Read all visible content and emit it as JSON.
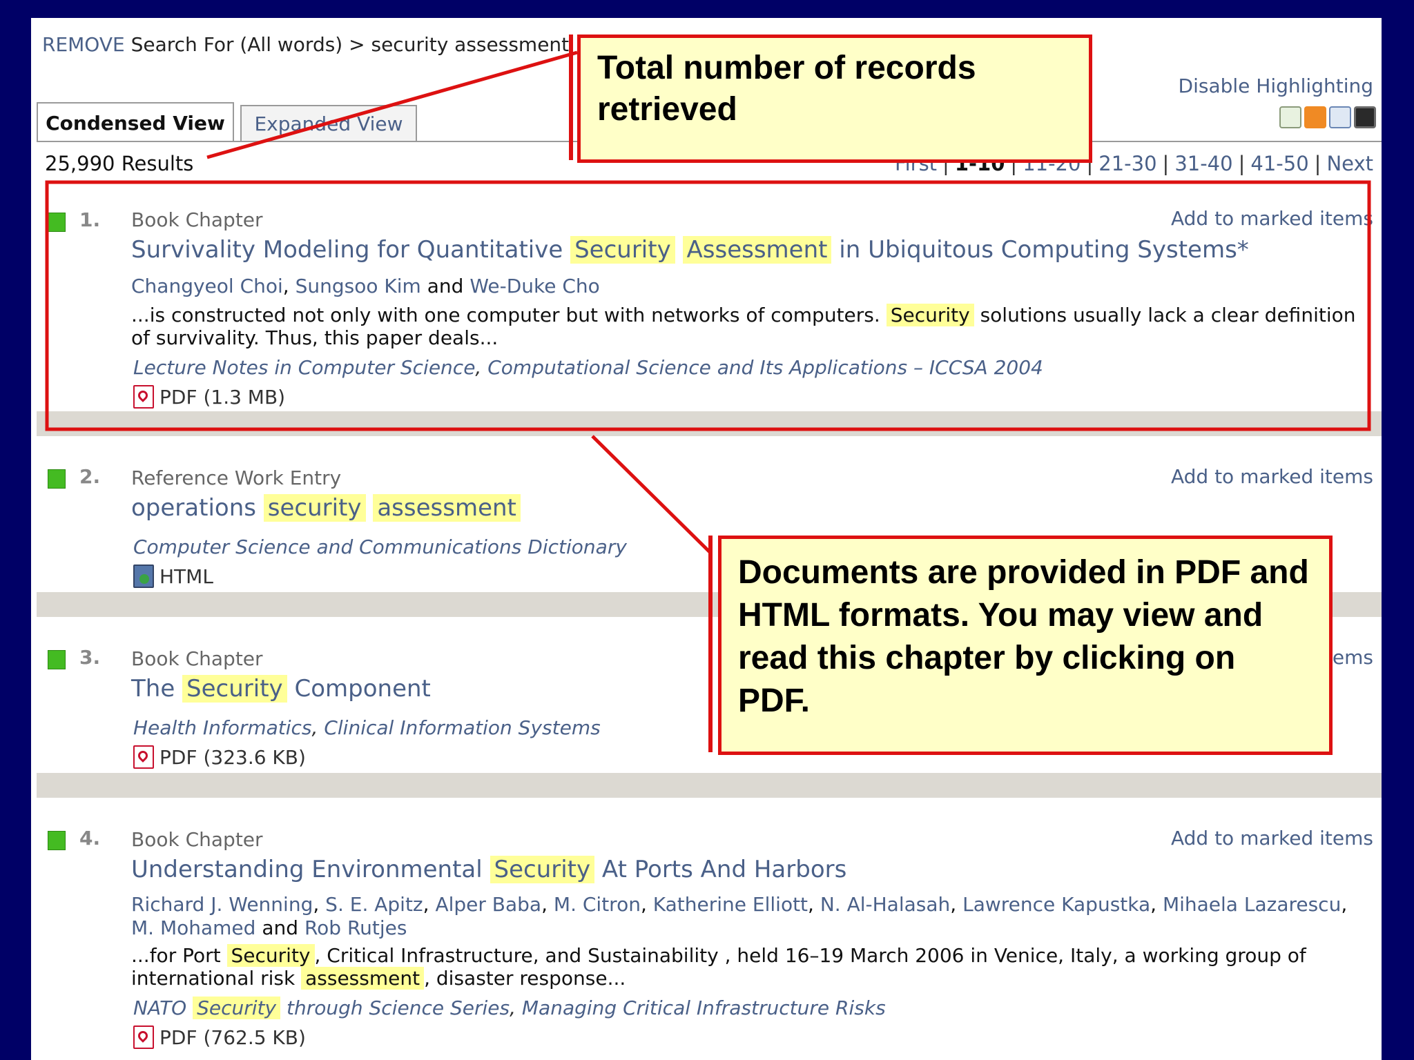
{
  "breadcrumb": {
    "remove": "REMOVE",
    "text": "Search For (All words) > security assessment"
  },
  "disable_highlighting": "Disable Highlighting",
  "tabs": [
    {
      "label": "Condensed View",
      "active": true
    },
    {
      "label": "Expanded View",
      "active": false
    }
  ],
  "results_count": "25,990 Results",
  "pager": {
    "first": "First",
    "pages": [
      "1-10",
      "11-20",
      "21-30",
      "31-40",
      "41-50"
    ],
    "next": "Next"
  },
  "add_to_marked": "Add to marked items",
  "results": [
    {
      "num": "1.",
      "type": "Book Chapter",
      "title_parts": [
        "Survivality Modeling for Quantitative ",
        "Security",
        " ",
        "Assessment",
        " in Ubiquitous Computing Systems*"
      ],
      "authors": [
        "Changyeol Choi",
        "Sungsoo Kim",
        "We-Duke Cho"
      ],
      "snippet_parts": [
        "...is constructed not only with one computer but with networks of computers. ",
        "Security",
        " solutions usually lack a clear definition of survivality. Thus, this paper deals..."
      ],
      "source": [
        "Lecture Notes in Computer Science",
        "Computational Science and Its Applications – ICCSA 2004"
      ],
      "format": "PDF (1.3 MB)"
    },
    {
      "num": "2.",
      "type": "Reference Work Entry",
      "title_parts": [
        "operations ",
        "security",
        " ",
        "assessment"
      ],
      "source": [
        "Computer Science and Communications Dictionary"
      ],
      "format": "HTML"
    },
    {
      "num": "3.",
      "type": "Book Chapter",
      "title_parts": [
        "The ",
        "Security",
        " Component"
      ],
      "source": [
        "Health Informatics",
        "Clinical Information Systems"
      ],
      "format": "PDF (323.6 KB)",
      "add_partial": "ems"
    },
    {
      "num": "4.",
      "type": "Book Chapter",
      "title_parts": [
        "Understanding Environmental ",
        "Security",
        " At Ports And Harbors"
      ],
      "authors": [
        "Richard J. Wenning",
        "S. E. Apitz",
        "Alper Baba",
        "M. Citron",
        "Katherine Elliott",
        "N. Al-Halasah",
        "Lawrence Kapustka",
        "Mihaela Lazarescu",
        "M. Mohamed",
        "Rob Rutjes"
      ],
      "snippet_parts": [
        "...for Port ",
        "Security",
        ", Critical Infrastructure, and Sustainability , held 16–19 March 2006 in Venice, Italy, a working group of international risk ",
        "assessment",
        ", disaster response..."
      ],
      "source_parts": [
        "NATO ",
        "Security",
        " through Science Series"
      ],
      "source_second": "Managing Critical Infrastructure Risks",
      "format": "PDF (762.5 KB)"
    }
  ],
  "and_word": "and",
  "comma": ", ",
  "annotations": {
    "records": "Total number of records retrieved",
    "documents": "Documents are provided in PDF and HTML formats. You may view and read this chapter by clicking on PDF."
  },
  "colors": {
    "background": "#000066",
    "link": "#4a6088",
    "highlight": "#ffff99",
    "annotation_border": "#dd1111",
    "annotation_fill": "#ffffc8",
    "marker": "#44bb22"
  },
  "icons": [
    "new-alert-icon",
    "rss-icon",
    "email-icon",
    "save-icon",
    "pdf-icon",
    "html-icon"
  ]
}
